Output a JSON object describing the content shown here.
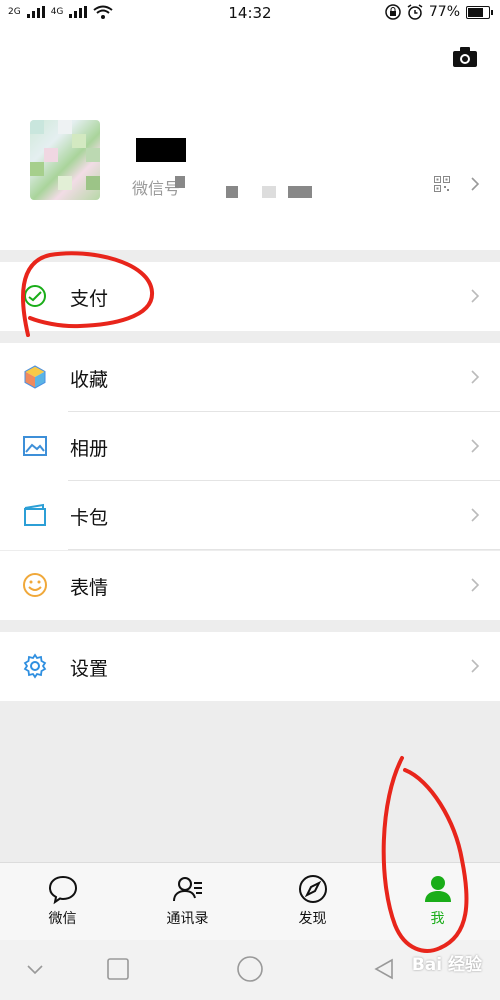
{
  "status_bar": {
    "signal_1": "2G",
    "signal_2": "4G",
    "time": "14:32",
    "battery_percent": "77%",
    "battery_level": 0.77,
    "icons": [
      "signal-icon",
      "wifi-icon",
      "lock-icon",
      "alarm-icon",
      "battery-icon"
    ]
  },
  "profile": {
    "nickname": "",
    "wechat_id_label": "微信号",
    "icons": [
      "camera-icon",
      "qr-code-icon",
      "chevron-right-icon"
    ]
  },
  "menu": {
    "pay": {
      "label": "支付",
      "icon": "wechat-pay-icon"
    },
    "favorites": {
      "label": "收藏",
      "icon": "cube-icon"
    },
    "album": {
      "label": "相册",
      "icon": "image-icon"
    },
    "cards": {
      "label": "卡包",
      "icon": "wallet-icon"
    },
    "stickers": {
      "label": "表情",
      "icon": "smiley-icon"
    },
    "settings": {
      "label": "设置",
      "icon": "gear-icon"
    }
  },
  "tabs": {
    "chats": {
      "label": "微信",
      "icon": "chat-bubble-icon"
    },
    "contacts": {
      "label": "通讯录",
      "icon": "contacts-icon"
    },
    "discover": {
      "label": "发现",
      "icon": "compass-icon"
    },
    "me": {
      "label": "我",
      "icon": "person-icon",
      "active": true
    }
  },
  "system_nav": {
    "icons": [
      "chevron-down-icon",
      "square-icon",
      "circle-icon",
      "back-triangle-icon"
    ]
  },
  "watermark": "Bai 经验",
  "colors": {
    "accent_green": "#1aad19",
    "annotation_red": "#e8251b",
    "background": "#ededed"
  }
}
